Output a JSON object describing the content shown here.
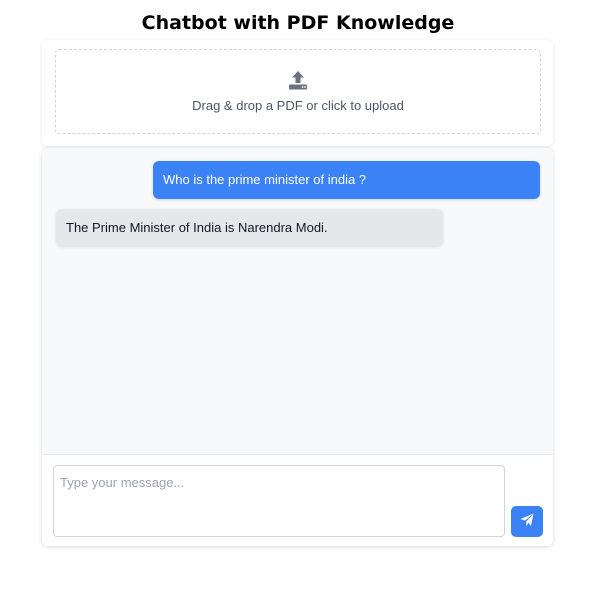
{
  "header": {
    "title": "Chatbot with PDF Knowledge"
  },
  "upload": {
    "icon": "upload-icon",
    "text": "Drag & drop a PDF or click to upload"
  },
  "chat": {
    "messages": [
      {
        "role": "user",
        "text": "Who is the prime minister of india ?"
      },
      {
        "role": "bot",
        "text": "The Prime Minister of India is Narendra Modi."
      }
    ]
  },
  "composer": {
    "placeholder": "Type your message...",
    "value": "",
    "send_icon": "send-icon"
  },
  "colors": {
    "accent": "#3b82f6",
    "bot_bubble": "#e5e7eb",
    "chat_background": "#f8f9fb"
  }
}
